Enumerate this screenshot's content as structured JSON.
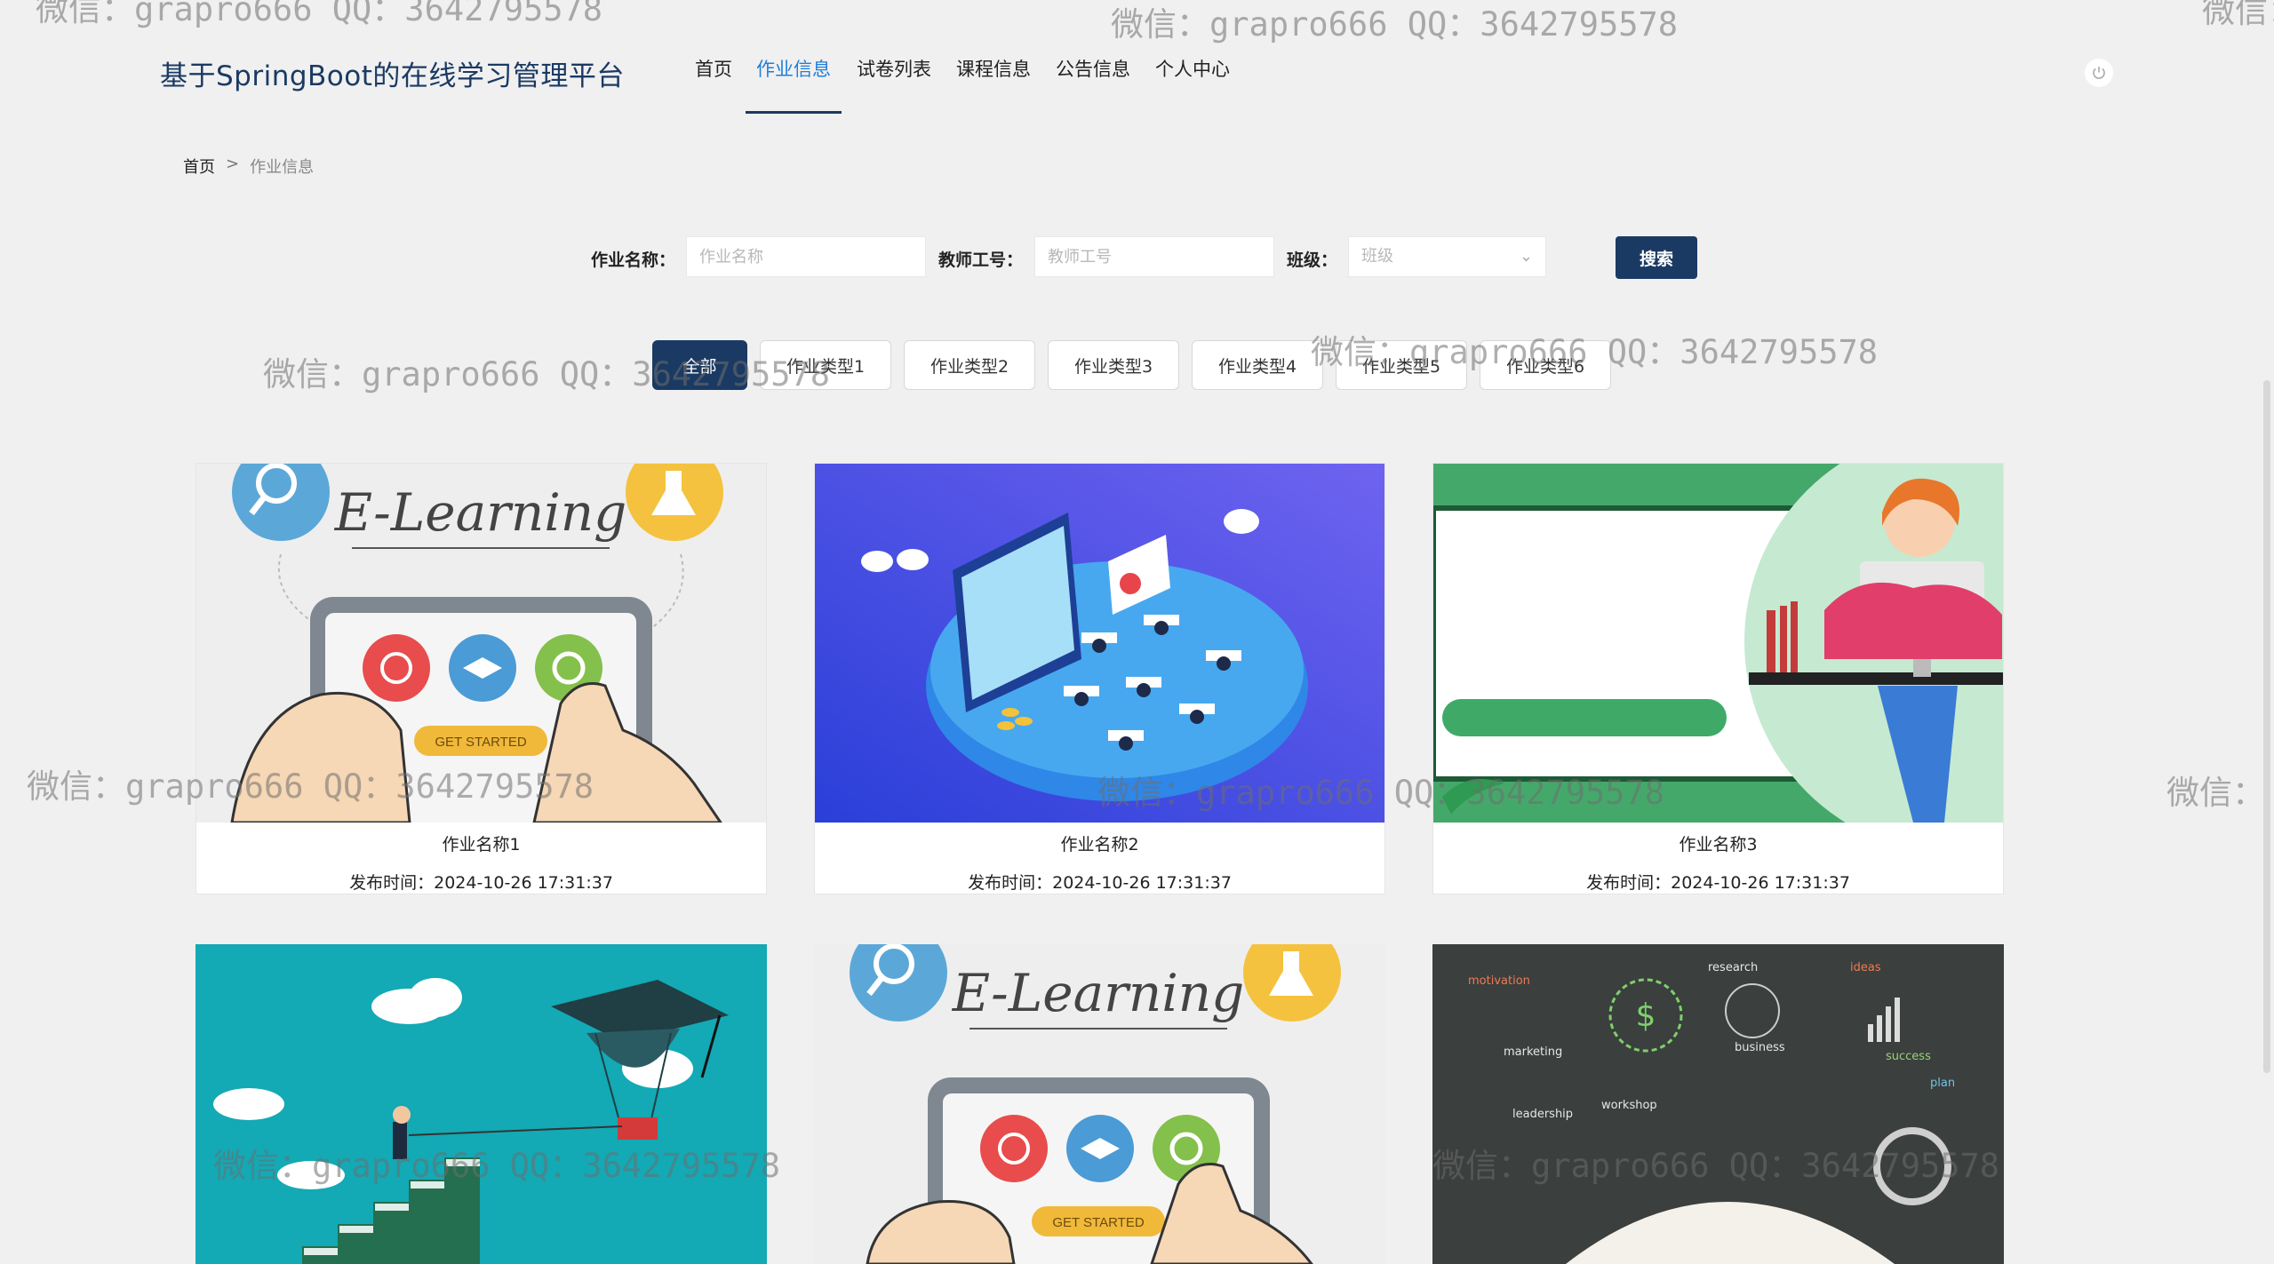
{
  "header": {
    "brand": "基于SpringBoot的在线学习管理平台",
    "nav": [
      "首页",
      "作业信息",
      "试卷列表",
      "课程信息",
      "公告信息",
      "个人中心"
    ],
    "active_index": 1
  },
  "breadcrumb": {
    "home": "首页",
    "separator": ">",
    "current": "作业信息"
  },
  "search": {
    "name_label": "作业名称：",
    "name_placeholder": "作业名称",
    "teacher_label": "教师工号：",
    "teacher_placeholder": "教师工号",
    "class_label": "班级：",
    "class_placeholder": "班级",
    "button": "搜索"
  },
  "categories": [
    "全部",
    "作业类型1",
    "作业类型2",
    "作业类型3",
    "作业类型4",
    "作业类型5",
    "作业类型6"
  ],
  "cards": [
    {
      "name": "作业名称1",
      "time_label": "发布时间：",
      "time": "2024-10-26 17:31:37"
    },
    {
      "name": "作业名称2",
      "time_label": "发布时间：",
      "time": "2024-10-26 17:31:37"
    },
    {
      "name": "作业名称3",
      "time_label": "发布时间：",
      "time": "2024-10-26 17:31:37"
    }
  ],
  "images": {
    "elearning_title": "E-Learning",
    "get_started": "GET STARTED",
    "chalk_words": [
      "motivation",
      "research",
      "marketing",
      "business",
      "workshop",
      "leadership",
      "success",
      "plan",
      "ideas"
    ]
  },
  "watermarks": [
    "微信：grapro666 QQ：3642795578",
    "微信：grapro666 QQ：3642795578",
    "微信：",
    "微信：grapro666 QQ：3642795578",
    "微信：grapro666 QQ：3642795578",
    "微信：grapro666 QQ：3642795578",
    "微信：grapro666 QQ：3642795578",
    "微信：",
    "微信：grapro666 QQ：3642795578",
    "微信：grapro666 QQ：3642795578"
  ],
  "colors": {
    "primary": "#1b3a63",
    "active_nav": "#1f7fd9",
    "page_bg": "#f0f0f0"
  }
}
